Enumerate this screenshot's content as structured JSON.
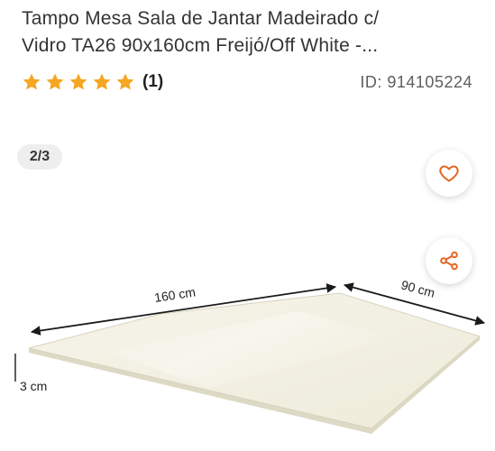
{
  "product": {
    "title_line1": "Tampo Mesa Sala de Jantar Madeirado c/",
    "title_line2": "Vidro TA26 90x160cm Freijó/Off White -...",
    "rating_value": 5,
    "rating_count": "(1)",
    "id_text": "ID: 914105224"
  },
  "gallery": {
    "pager": "2/3",
    "dimensions": {
      "length": "160 cm",
      "width": "90 cm",
      "height": "3 cm"
    }
  },
  "colors": {
    "star": "#f5a623",
    "accent": "#e5641f",
    "tabletop": "#f3f1e4"
  },
  "icons": {
    "favorite": "heart-icon",
    "share": "share-icon",
    "star": "star-icon"
  }
}
